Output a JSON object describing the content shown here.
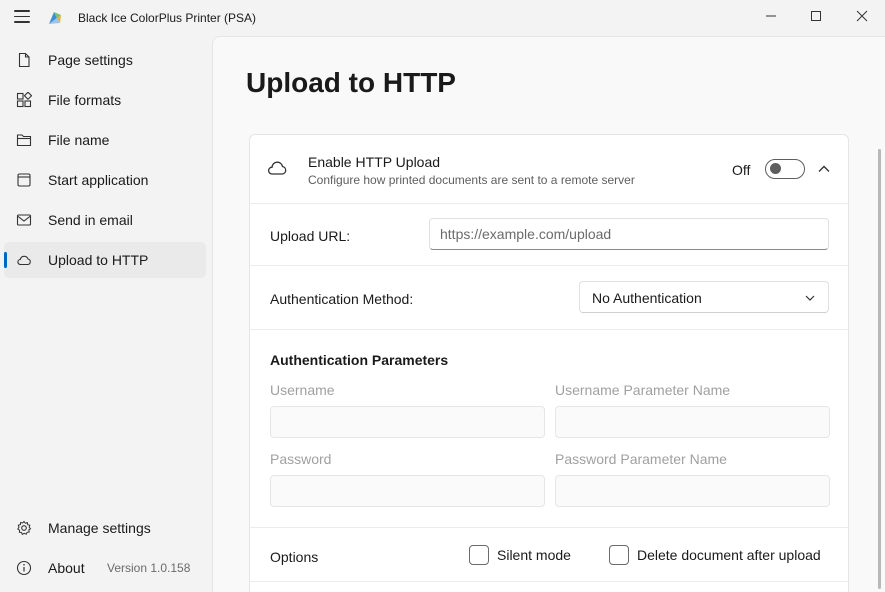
{
  "window": {
    "title": "Black Ice ColorPlus Printer (PSA)"
  },
  "sidebar": {
    "items": [
      {
        "label": "Page settings",
        "icon": "page-icon"
      },
      {
        "label": "File formats",
        "icon": "file-formats-icon"
      },
      {
        "label": "File name",
        "icon": "folder-icon"
      },
      {
        "label": "Start application",
        "icon": "window-icon"
      },
      {
        "label": "Send in email",
        "icon": "mail-icon"
      },
      {
        "label": "Upload to HTTP",
        "icon": "cloud-icon",
        "active": true
      }
    ],
    "footer": {
      "manage_label": "Manage settings",
      "about_label": "About",
      "version": "Version 1.0.158"
    }
  },
  "page": {
    "title": "Upload to HTTP"
  },
  "upload": {
    "enable_title": "Enable HTTP Upload",
    "enable_subtitle": "Configure how printed documents are sent to a remote server",
    "toggle_state": "Off",
    "url_label": "Upload URL:",
    "url_placeholder": "https://example.com/upload",
    "url_value": "",
    "auth_method_label": "Authentication Method:",
    "auth_method_value": "No Authentication",
    "params_title": "Authentication Parameters",
    "username_label": "Username",
    "username_param_label": "Username Parameter Name",
    "password_label": "Password",
    "password_param_label": "Password Parameter Name",
    "options_label": "Options",
    "silent_mode_label": "Silent mode",
    "silent_mode_checked": false,
    "delete_after_label": "Delete document after upload",
    "delete_after_checked": false
  },
  "colors": {
    "accent": "#0067c0",
    "background": "#f3f3f3",
    "card": "#ffffff"
  }
}
